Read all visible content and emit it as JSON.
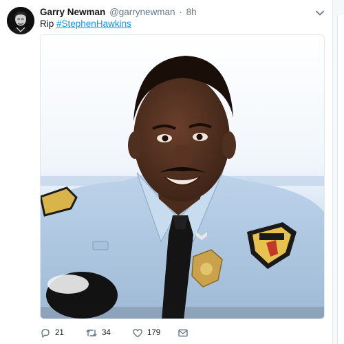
{
  "tweet": {
    "author_name": "Garry Newman",
    "author_handle": "@garrynewman",
    "separator": "·",
    "time": "8h",
    "text_prefix": "Rip ",
    "hashtag": "#StephenHawkins"
  },
  "actions": {
    "reply_count": "21",
    "retweet_count": "34",
    "like_count": "179"
  },
  "icons": {
    "caret": "chevron-down-icon",
    "reply": "reply-icon",
    "retweet": "retweet-icon",
    "like": "heart-icon",
    "message": "envelope-icon"
  },
  "colors": {
    "link": "#1b95e0",
    "muted": "#657786",
    "text": "#14171a"
  }
}
